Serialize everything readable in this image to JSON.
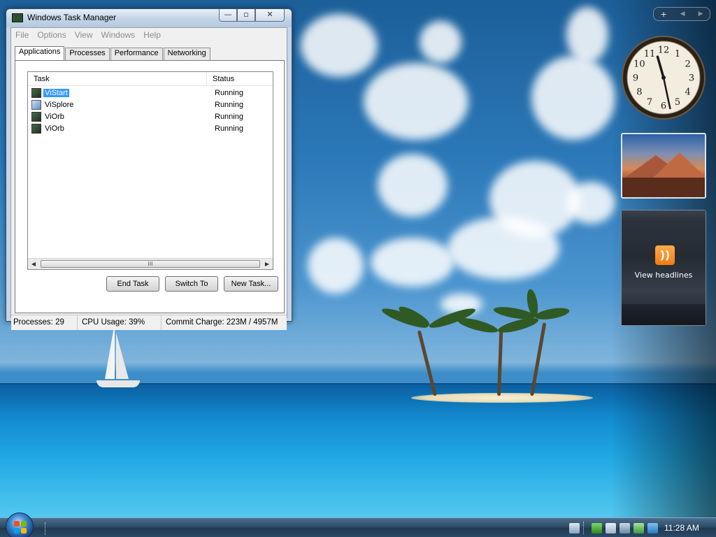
{
  "window": {
    "title": "Windows Task Manager",
    "minimize_label": "—",
    "maximize_label": "▫",
    "close_label": "✕"
  },
  "menu": [
    "File",
    "Options",
    "View",
    "Windows",
    "Help"
  ],
  "tabs": [
    {
      "label": "Applications",
      "active": true
    },
    {
      "label": "Processes",
      "active": false
    },
    {
      "label": "Performance",
      "active": false
    },
    {
      "label": "Networking",
      "active": false
    }
  ],
  "task_list": {
    "columns": {
      "task": "Task",
      "status": "Status"
    },
    "rows": [
      {
        "name": "ViStart",
        "status": "Running",
        "icon": "app-icon",
        "selected": true
      },
      {
        "name": "ViSplore",
        "status": "Running",
        "icon": "explorer-icon",
        "selected": false
      },
      {
        "name": "ViOrb",
        "status": "Running",
        "icon": "app-icon",
        "selected": false
      },
      {
        "name": "ViOrb",
        "status": "Running",
        "icon": "app-icon",
        "selected": false
      }
    ],
    "scroll_thumb_label": "III",
    "scroll_left": "◀",
    "scroll_right": "▶"
  },
  "buttons": {
    "end_task": "End Task",
    "switch_to": "Switch To",
    "new_task": "New Task..."
  },
  "statusbar": {
    "processes": "Processes: 29",
    "cpu": "CPU Usage: 39%",
    "commit": "Commit Charge: 223M / 4957M"
  },
  "gadgets": {
    "toolbar_add": "+",
    "toolbar_prev": "◀",
    "toolbar_next": "▶",
    "clock": {
      "hour": 11,
      "minute": 28
    },
    "clock_numerals": [
      "12",
      "1",
      "2",
      "3",
      "4",
      "5",
      "6",
      "7",
      "8",
      "9",
      "10",
      "11"
    ],
    "rss_label": "View headlines",
    "rss_glyph": "))"
  },
  "taskbar": {
    "time": "11:28 AM"
  },
  "colors": {
    "selection": "#3399ff",
    "rss_orange": "#f07a12",
    "taskbar": "#2e4c66"
  }
}
